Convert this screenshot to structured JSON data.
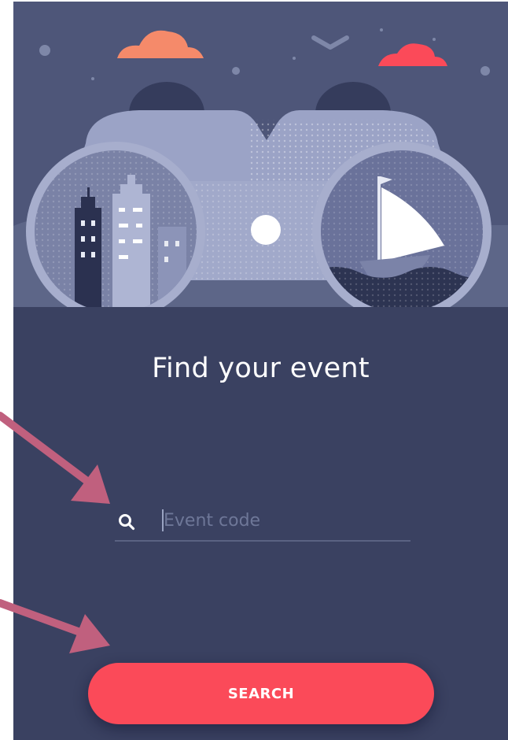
{
  "screen": {
    "title": "Find your event"
  },
  "search": {
    "placeholder": "Event code",
    "value": ""
  },
  "button": {
    "label": "SEARCH"
  },
  "icons": {
    "search": "search-icon"
  },
  "colors": {
    "background": "#3a4161",
    "accent": "#fb4a59",
    "annotation_arrow": "#c0607e"
  }
}
